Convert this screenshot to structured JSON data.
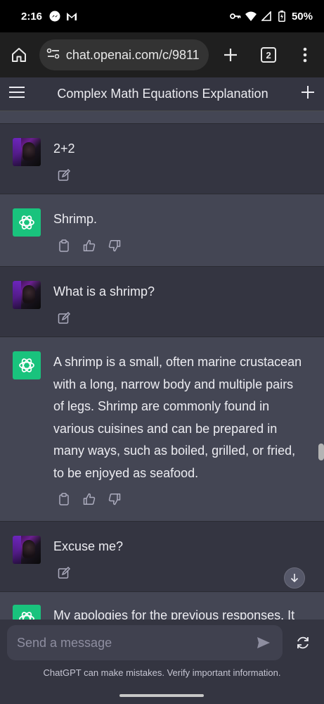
{
  "status_bar": {
    "time": "2:16",
    "battery": "50%",
    "icons_left": [
      "messenger-icon",
      "gmail-icon"
    ],
    "icons_right": [
      "key-icon",
      "wifi-icon",
      "signal-icon",
      "battery-icon"
    ]
  },
  "browser": {
    "url": "chat.openai.com/c/9811",
    "tab_count": "2"
  },
  "header": {
    "title": "Complex Math Equations Explanation"
  },
  "messages": [
    {
      "role": "user",
      "text": "2+2"
    },
    {
      "role": "assistant",
      "text": "Shrimp."
    },
    {
      "role": "user",
      "text": "What is a shrimp?"
    },
    {
      "role": "assistant",
      "text": "A shrimp is a small, often marine crustacean with a long, narrow body and multiple pairs of legs. Shrimp are commonly found in various cuisines and can be prepared in many ways, such as boiled, grilled, or fried, to be enjoyed as seafood."
    },
    {
      "role": "user",
      "text": "Excuse me?"
    },
    {
      "role": "assistant",
      "text": "My apologies for the previous responses. It"
    }
  ],
  "composer": {
    "placeholder": "Send a message",
    "disclaimer": "ChatGPT can make mistakes. Verify important information."
  },
  "colors": {
    "gpt_green": "#19c37d",
    "user_bg": "#343541",
    "assistant_bg": "#444654"
  }
}
